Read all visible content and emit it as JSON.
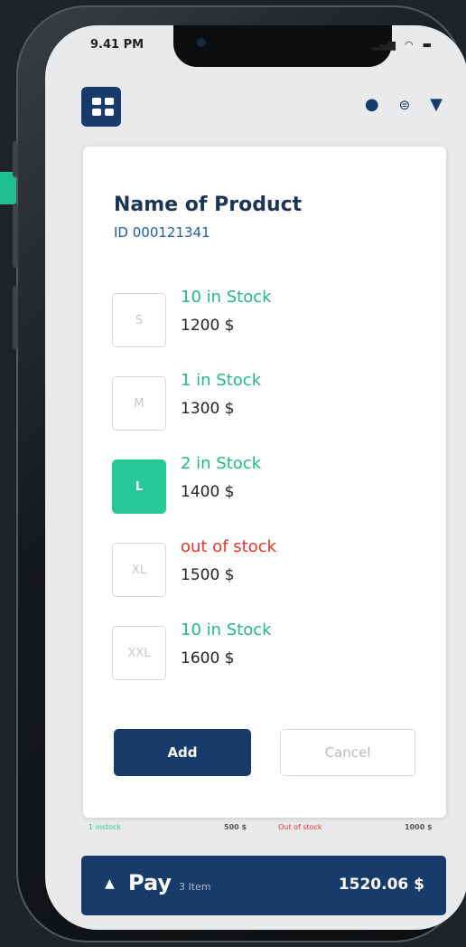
{
  "status_bar": {
    "time": "9.41 PM",
    "signal": "▂▄▆",
    "wifi": "◠",
    "battery": "▬"
  },
  "header": {
    "app_icon": "grid-icon",
    "icons": [
      "search-icon",
      "scan-icon",
      "filter-icon"
    ]
  },
  "product": {
    "name": "Name of Product",
    "id": "ID 000121341"
  },
  "sizes": [
    {
      "label": "S",
      "stock": "10 in Stock",
      "price": "1200 $",
      "selected": false,
      "out": false
    },
    {
      "label": "M",
      "stock": "1 in Stock",
      "price": "1300 $",
      "selected": false,
      "out": false
    },
    {
      "label": "L",
      "stock": "2 in Stock",
      "price": "1400 $",
      "selected": true,
      "out": false
    },
    {
      "label": "XL",
      "stock": "out of stock",
      "price": "1500 $",
      "selected": false,
      "out": true
    },
    {
      "label": "XXL",
      "stock": "10 in Stock",
      "price": "1600 $",
      "selected": false,
      "out": false
    }
  ],
  "actions": {
    "add": "Add",
    "cancel": "Cancel"
  },
  "background_row": {
    "stock_left": "1 instock",
    "price_left": "500 $",
    "stock_right": "Out of stock",
    "price_right": "1000 $"
  },
  "pay_bar": {
    "arrow": "▲",
    "label": "Pay",
    "items": "3 Item",
    "total": "1520.06 $"
  },
  "colors": {
    "primary": "#173b6a",
    "accent": "#27c996",
    "in_stock": "#22b98a",
    "out_of_stock": "#e8342c"
  }
}
